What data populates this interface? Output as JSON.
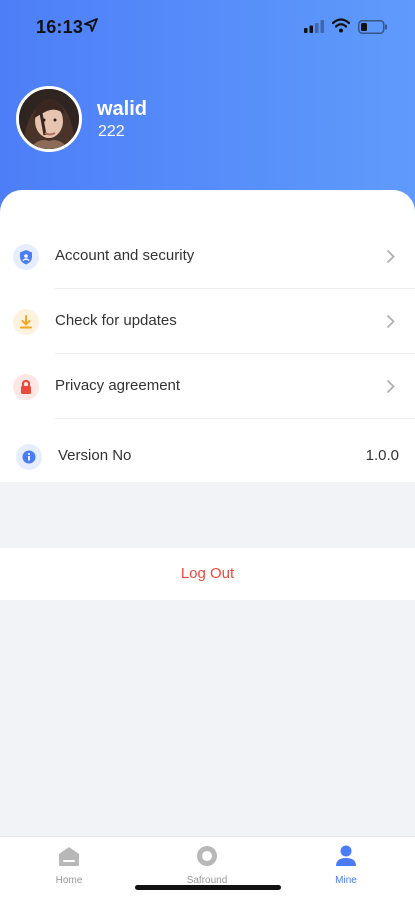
{
  "status_bar": {
    "time": "16:13"
  },
  "profile": {
    "name": "walid",
    "id": "222"
  },
  "menu": [
    {
      "label": "Account and security",
      "icon": "shield-icon",
      "color": "#4a7cf6"
    },
    {
      "label": "Check for updates",
      "icon": "download-icon",
      "color": "#f5a623"
    },
    {
      "label": "Privacy agreement",
      "icon": "lock-icon",
      "color": "#e84b3c"
    }
  ],
  "version": {
    "label": "Version No",
    "value": "1.0.0",
    "icon": "info-icon"
  },
  "logout": {
    "label": "Log Out",
    "color": "#e84b3c"
  },
  "tabbar": [
    {
      "label": "Home",
      "icon": "home-icon",
      "active": false
    },
    {
      "label": "Safround",
      "icon": "safround-icon",
      "active": false
    },
    {
      "label": "Mine",
      "icon": "person-icon",
      "active": true
    }
  ],
  "colors": {
    "accent": "#4a7cf6",
    "header_start": "#4d7ef8",
    "header_end": "#5f9bfb"
  }
}
